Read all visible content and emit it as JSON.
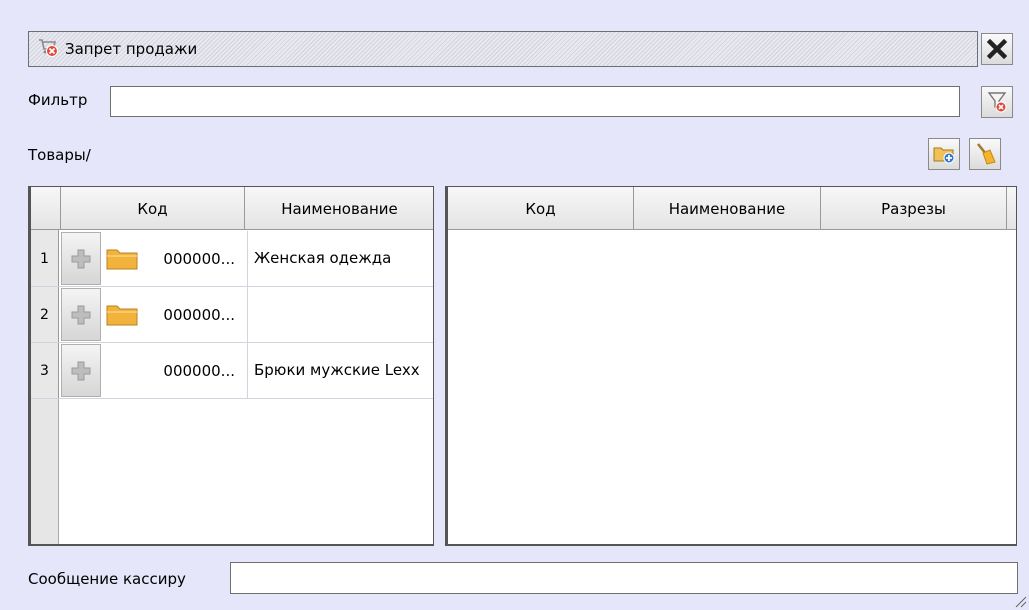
{
  "window": {
    "title": "Запрет продажи",
    "title_icon": "cart-forbidden-icon",
    "close_icon": "close-x-icon"
  },
  "filter": {
    "label": "Фильтр",
    "value": "",
    "clear_icon": "funnel-clear-icon"
  },
  "goods": {
    "label": "Товары/",
    "add_folder_icon": "folder-add-icon",
    "broom_icon": "broom-icon"
  },
  "left_grid": {
    "columns": [
      "Код",
      "Наименование"
    ],
    "rows": [
      {
        "num": "1",
        "code": "000000...",
        "name": "Женская одежда",
        "folder": true
      },
      {
        "num": "2",
        "code": "000000...",
        "name": "",
        "folder": true
      },
      {
        "num": "3",
        "code": "000000...",
        "name": "Брюки мужские Lexx",
        "folder": false
      }
    ]
  },
  "right_grid": {
    "columns": [
      "Код",
      "Наименование",
      "Разрезы"
    ]
  },
  "cashier": {
    "label": "Сообщение кассиру",
    "value": ""
  },
  "colors": {
    "background": "#e6e6fa",
    "folder": "#f2b33d",
    "close_red": "#d9342b"
  }
}
